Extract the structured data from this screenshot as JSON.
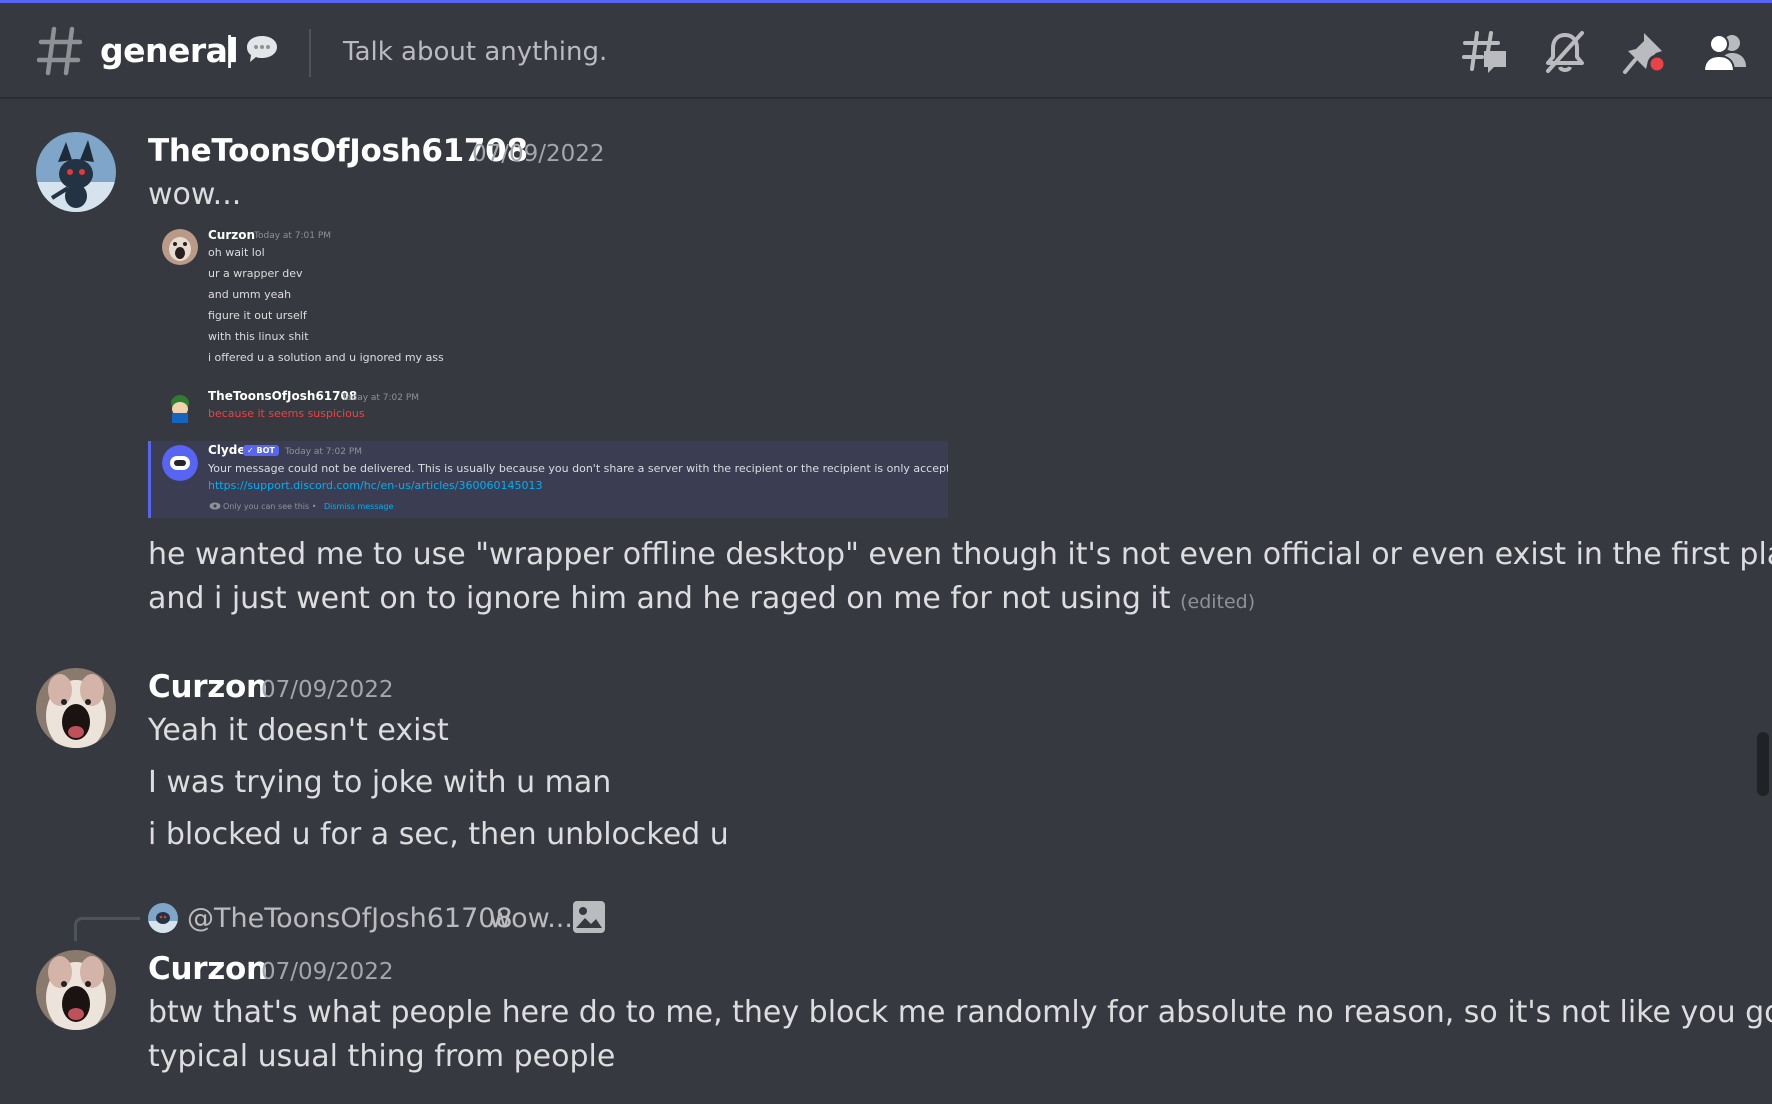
{
  "header": {
    "channel_name": "general",
    "separator": "|",
    "topic": "Talk about anything."
  },
  "messages": [
    {
      "username": "TheToonsOfJosh61708",
      "timestamp": "07/09/2022",
      "lines": [
        "wow...",
        "he wanted me to use \"wrapper offline desktop\" even though it's not even official or even exist in the first place",
        "and i just went on to ignore him and he raged on me for not using it"
      ],
      "edited_label": "(edited)"
    },
    {
      "username": "Curzon",
      "timestamp": "07/09/2022",
      "lines": [
        "Yeah it doesn't exist",
        "I was trying to joke with u man",
        "i blocked u for a sec, then unblocked u"
      ]
    },
    {
      "reply": {
        "mention": "@TheToonsOfJosh61708",
        "preview": "wow..."
      },
      "username": "Curzon",
      "timestamp": "07/09/2022",
      "lines": [
        "btw that's what people here do to me, they block me randomly for absolute no reason, so it's not like you got the",
        "typical usual thing from people"
      ]
    }
  ],
  "screenshot": {
    "m1": {
      "name": "Curzon",
      "time": "Today at 7:01 PM",
      "lines": [
        "oh wait lol",
        "ur a wrapper dev",
        "and umm yeah",
        "figure it out urself",
        "with this linux shit",
        "i offered u a solution and u ignored my ass"
      ]
    },
    "m2": {
      "name": "TheToonsOfJosh61708",
      "time": "Today at 7:02 PM",
      "line": "because it seems suspicious"
    },
    "m3": {
      "name": "Clyde",
      "bot_tag": "✓ BOT",
      "time": "Today at 7:02 PM",
      "line": "Your message could not be delivered. This is usually because you don't share a server with the recipient or the recipient is only accepting",
      "link": "https://support.discord.com/hc/en-us/articles/360060145013",
      "footer": "Only you can see this •",
      "dismiss": "Dismiss message"
    }
  },
  "colors": {
    "background": "#36393f",
    "accent": "#5865f2",
    "username": "#ffffff",
    "muted": "#a3a6aa",
    "error_red": "#ed4245",
    "link": "#00aff4"
  },
  "icons": [
    "hashtag-icon",
    "speech-bubble-icon",
    "threads-icon",
    "mute-bell-icon",
    "pinned-messages-icon",
    "member-list-icon",
    "image-attachment-icon"
  ]
}
